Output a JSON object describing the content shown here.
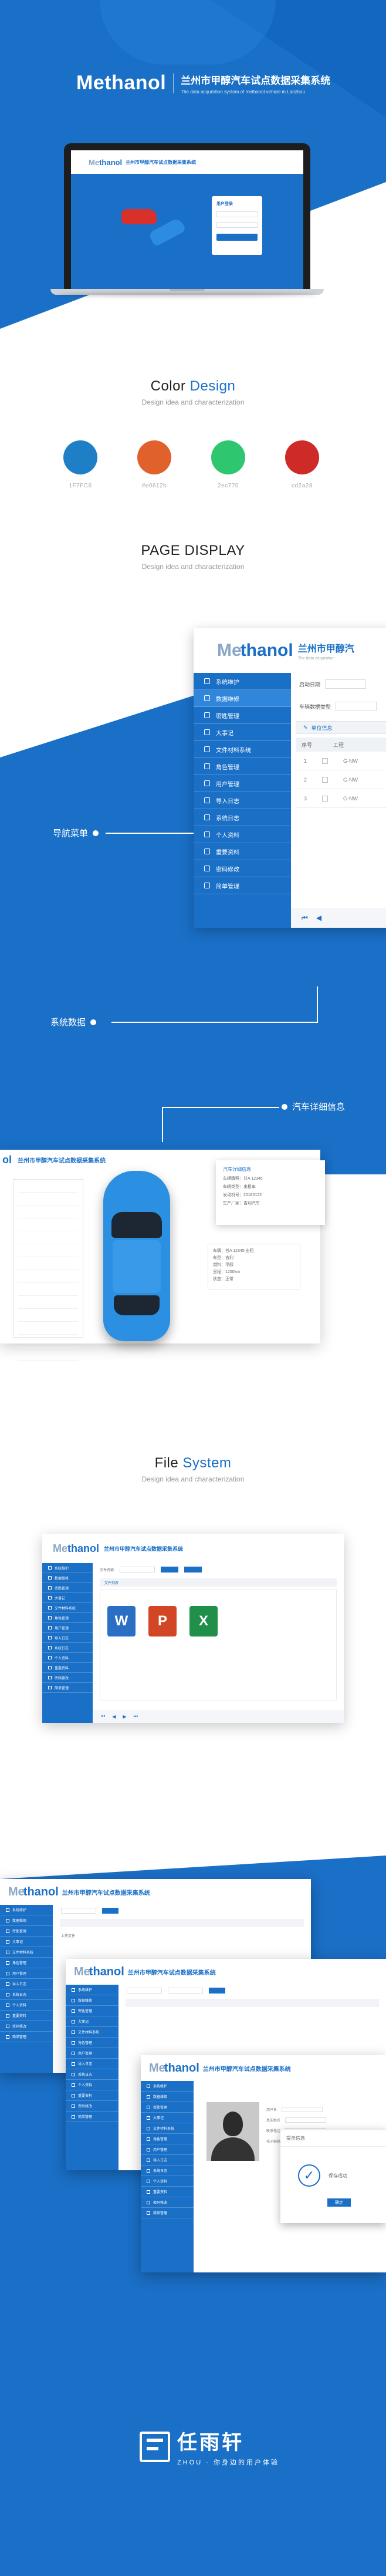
{
  "hero": {
    "logo": "Methanol",
    "title_zh": "兰州市甲醇汽车试点数据采集系统",
    "title_en": "The data acquisition system of methanol vehicle in Lanzhou",
    "screen_logo_a": "Me",
    "screen_logo_b": "thanol",
    "screen_title": "兰州市甲醇汽车试点数据采集系统",
    "login_title": "用户登录"
  },
  "color": {
    "title_a": "Color ",
    "title_b": "Design",
    "subtitle": "Design idea and characterization",
    "swatches": [
      {
        "hex": "#1F7FC6",
        "label": "1F7FC6"
      },
      {
        "hex": "#E0612B",
        "label": "#e0612b"
      },
      {
        "hex": "#2EC770",
        "label": "2ec770"
      },
      {
        "hex": "#CD2A28",
        "label": "cd2a28"
      }
    ]
  },
  "display": {
    "title": "PAGE DISPLAY",
    "subtitle": "Design idea and characterization",
    "logo_a": "Me",
    "logo_b": "thanol",
    "title_zh": "兰州市甲醇汽",
    "title_en": "The data acquisition",
    "menu": [
      "系统维护",
      "数据维修",
      "密匙管理",
      "大事记",
      "文件材料系统",
      "角色管理",
      "用户管理",
      "导入日志",
      "系统日志",
      "个人资料",
      "重要资料",
      "密码修改",
      "简单管理"
    ],
    "form_label_1": "启动日期",
    "form_label_2": "车辆数据类型",
    "toolbar": "单位信息",
    "table_headers": [
      "序号",
      "",
      "工程"
    ],
    "table_rows": [
      [
        "1",
        "G-NW"
      ],
      [
        "2",
        "G-NW"
      ],
      [
        "3",
        "G-NW"
      ]
    ],
    "callout_nav": "导航菜单",
    "callout_data": "系统数据",
    "callout_detail": "汽车详细信息",
    "detail_head": "兰州市甲醇汽车试点数据采集系统",
    "popup_title": "汽车详细信息",
    "popup_lines": [
      "车辆牌照：甘A 12345",
      "车辆类型：出租车",
      "发动机号：20180122",
      "生产厂家：吉利汽车"
    ],
    "info_lines": [
      "车牌：甘A 12345 出租",
      "车型：吉利",
      "燃料：甲醇",
      "里程：1200km",
      "状态：正常"
    ]
  },
  "file": {
    "title_a": "File ",
    "title_b": "System",
    "subtitle": "Design idea and characterization",
    "logo_a": "Me",
    "logo_b": "thanol",
    "title_zh": "兰州市甲醇汽车试点数据采集系统",
    "menu": [
      "系统维护",
      "数据维修",
      "密匙管理",
      "大事记",
      "文件材料系统",
      "角色管理",
      "用户管理",
      "导入日志",
      "系统日志",
      "个人资料",
      "重要资料",
      "密码修改",
      "简单管理"
    ],
    "search_label": "文件名称",
    "toolbar": "文件列表",
    "docs": [
      {
        "letter": "W",
        "color": "#2b6fc4"
      },
      {
        "letter": "P",
        "color": "#d24625"
      },
      {
        "letter": "X",
        "color": "#1f8f4a"
      }
    ]
  },
  "stack": {
    "logo_a": "Me",
    "logo_b": "thanol",
    "title_zh": "兰州市甲醇汽车试点数据采集系统",
    "menu": [
      "系统维护",
      "数据维修",
      "密匙管理",
      "大事记",
      "文件材料系统",
      "角色管理",
      "用户管理",
      "导入日志",
      "系统日志",
      "个人资料",
      "重要资料",
      "密码修改",
      "简单管理"
    ],
    "upload_label": "上传文件",
    "profile_lines": [
      "用户名",
      "真实姓名",
      "联系电话",
      "电子邮箱"
    ],
    "modal_title": "提示信息",
    "modal_msg": "保存成功",
    "modal_btn": "确定"
  },
  "footer": {
    "name_zh": "任雨轩",
    "name_en": "ZHOU · 你身边的用户体验",
    "mark": "fz"
  }
}
